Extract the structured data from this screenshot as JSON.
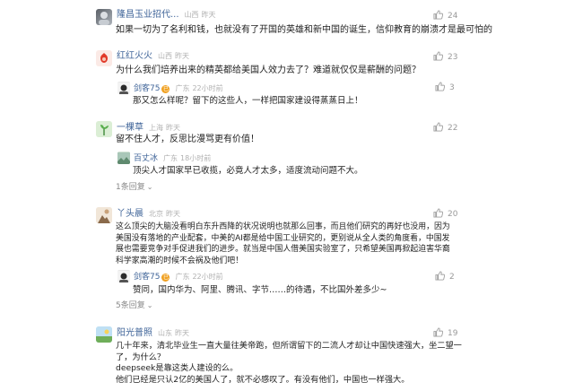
{
  "comments": [
    {
      "user": "隆昌玉业招代...",
      "loc": "山西",
      "time": "昨天",
      "likes": "24",
      "lines": [
        "如果一切为了名利和钱，也就没有了开国的英雄和新中国的诞生，信仰教育的崩溃才是最可怕的"
      ]
    },
    {
      "user": "红红火火",
      "loc": "山西",
      "time": "昨天",
      "likes": "23",
      "lines": [
        "为什么我们培养出来的精英都给美国人效力去了？难道就仅仅是薪酬的问题？"
      ],
      "replies": [
        {
          "user": "剑客75",
          "badge": "已",
          "loc": "广东",
          "time": "22小时前",
          "likes": "3",
          "text": "那又怎么样呢？留下的这些人，一样把国家建设得蒸蒸日上！"
        }
      ]
    },
    {
      "user": "一棵草",
      "loc": "上海",
      "time": "昨天",
      "likes": "22",
      "lines": [
        "留不住人才，反思比漫骂更有价值！"
      ],
      "replies": [
        {
          "user": "百丈冰",
          "loc": "广东",
          "time": "18小时前",
          "text": "顶尖人才国家早已收揽，必竟人才太多，适度流动问题不大。"
        }
      ],
      "more": "1条回复"
    },
    {
      "user": "丫头晨",
      "loc": "北京",
      "time": "昨天",
      "likes": "20",
      "lines": [
        "这么顶尖的大脑没看明白东升西降的状况说明也就那么回事，而且他们研究的再好也没用，因为",
        "美国没有落地的产业配套，中美的AI都是给中国工业研究的，更别说从全人类的角度看，中国发",
        "展也需要竞争对手促进我们的进步。就当是中国人借美国实验室了，只希望美国再掀起迫害华裔",
        "科学家高潮的时候不会祸及他们吧！"
      ],
      "replies": [
        {
          "user": "剑客75",
          "badge": "已",
          "loc": "广东",
          "time": "22小时前",
          "likes": "2",
          "text": "赞同，国内华为、阿里、腾讯、字节……的待遇，不比国外差多少~"
        }
      ],
      "more": "5条回复"
    },
    {
      "user": "阳光普照",
      "loc": "山东",
      "time": "昨天",
      "likes": "19",
      "lines": [
        "几十年来，清北毕业生一直大量往美帝跑，但所谓留下的二流人才却让中国快速强大，坐二望一",
        "了，为什么？",
        "deepseek是靠这类人建设的么。",
        "他们已经是只认2亿的美国人了，就不必感叹了。有没有他们，中国也一样强大。"
      ]
    }
  ],
  "colors": {
    "username": "#406599",
    "meta": "#b0b0b0",
    "text": "#222222",
    "muted": "#999999"
  }
}
